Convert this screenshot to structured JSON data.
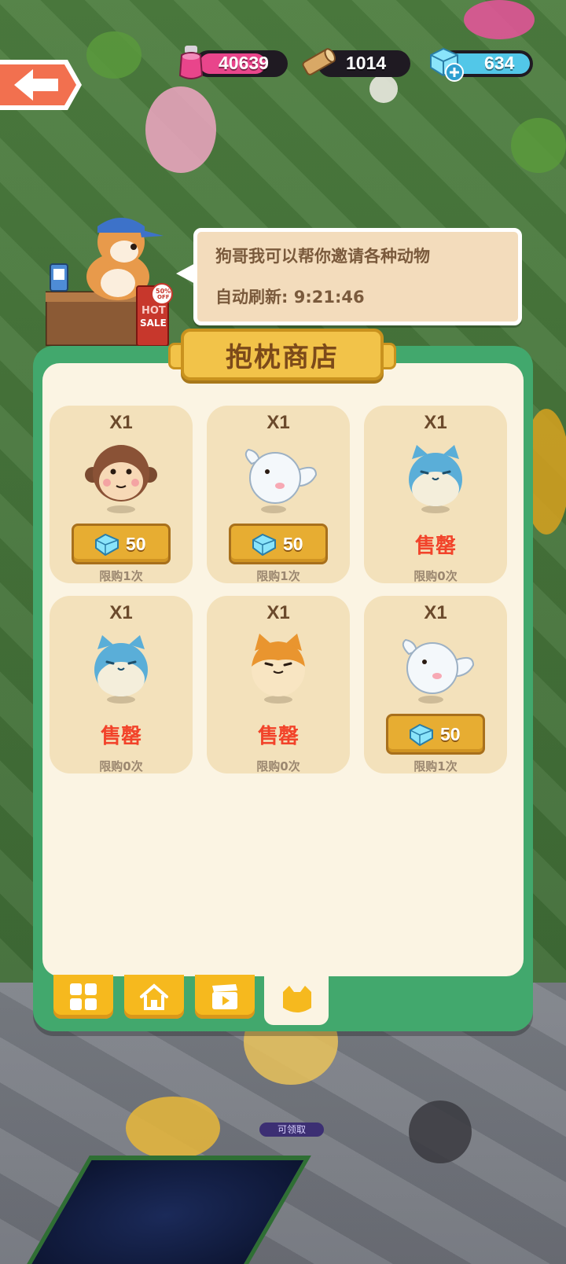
{
  "resources": {
    "potion": {
      "value": "40639",
      "icon": "pink-potion-icon",
      "color": "#e9458b"
    },
    "wood": {
      "value": "1014",
      "icon": "wood-log-icon"
    },
    "gem": {
      "value": "634",
      "icon": "diamond-icon",
      "color": "#52c7e8"
    }
  },
  "npc": {
    "sign": {
      "percent": "50%",
      "off": "OFF",
      "hot": "HOT",
      "sale": "SALE"
    },
    "bubble_line1": "狗哥我可以帮你邀请各种动物",
    "bubble_line2": "自动刷新: 9:21:46"
  },
  "shop": {
    "title": "抱枕商店",
    "items": [
      {
        "qty": "X1",
        "pet": "monkey",
        "price": "50",
        "sold_out": false,
        "limit": "限购1次"
      },
      {
        "qty": "X1",
        "pet": "white-bird",
        "price": "50",
        "sold_out": false,
        "limit": "限购1次"
      },
      {
        "qty": "X1",
        "pet": "blue-cat",
        "sold_label": "售罄",
        "sold_out": true,
        "limit": "限购0次"
      },
      {
        "qty": "X1",
        "pet": "blue-cat",
        "sold_label": "售罄",
        "sold_out": true,
        "limit": "限购0次"
      },
      {
        "qty": "X1",
        "pet": "shiba-dog",
        "sold_label": "售罄",
        "sold_out": true,
        "limit": "限购0次"
      },
      {
        "qty": "X1",
        "pet": "white-bird",
        "price": "50",
        "sold_out": false,
        "limit": "限购1次"
      }
    ],
    "tabs": [
      {
        "icon": "grid-icon",
        "active": false
      },
      {
        "icon": "house-icon",
        "active": false
      },
      {
        "icon": "clapperboard-icon",
        "active": false
      },
      {
        "icon": "cat-face-icon",
        "active": true
      }
    ]
  },
  "scene": {
    "claim_label": "可领取"
  },
  "colors": {
    "panel_green": "#42a86d",
    "panel_cream": "#fbf4e3",
    "card": "#f3e1bb",
    "price_gold": "#e7ad32",
    "sold_red": "#f2432a"
  }
}
